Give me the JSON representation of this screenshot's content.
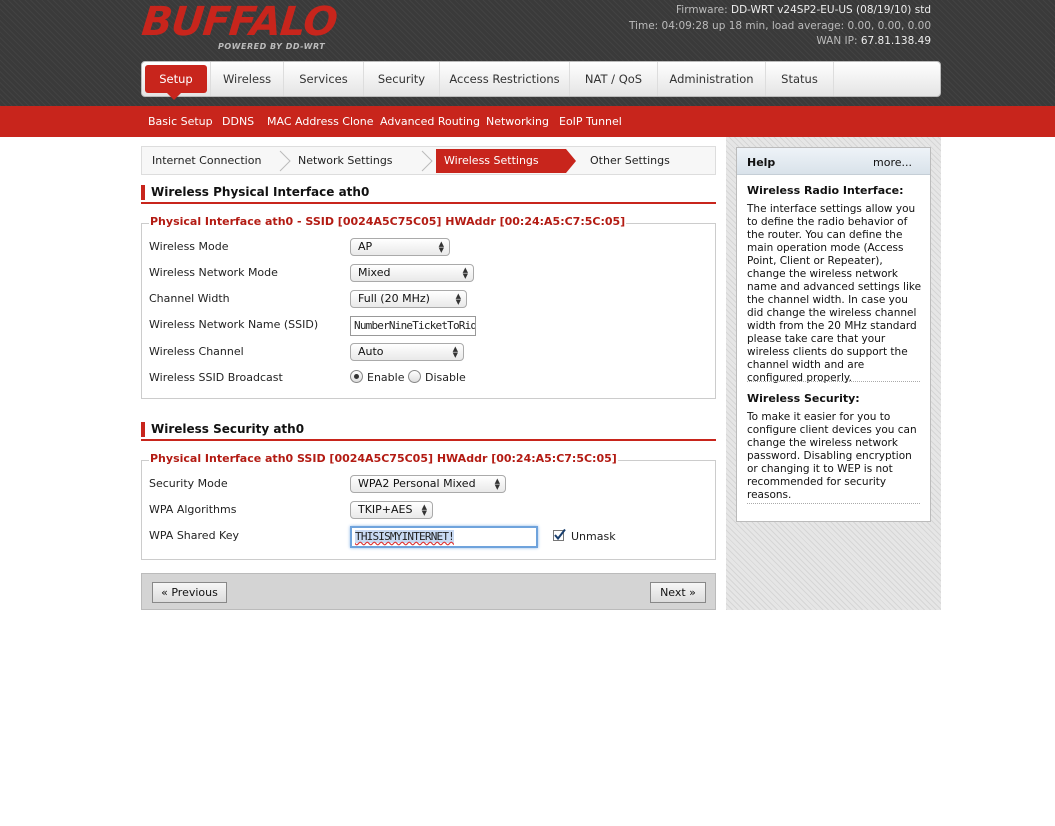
{
  "header": {
    "brand": "BUFFALO",
    "tagline": "POWERED BY DD-WRT",
    "firmware_label": "Firmware:",
    "firmware_value": "DD-WRT v24SP2-EU-US (08/19/10) std",
    "time_label": "Time:",
    "time_value": "04:09:28 up 18 min, load average: 0.00, 0.00, 0.00",
    "wanip_label": "WAN IP:",
    "wanip_value": "67.81.138.49"
  },
  "main_nav": [
    "Setup",
    "Wireless",
    "Services",
    "Security",
    "Access Restrictions",
    "NAT / QoS",
    "Administration",
    "Status"
  ],
  "sub_nav": [
    "Basic Setup",
    "DDNS",
    "MAC Address Clone",
    "Advanced Routing",
    "Networking",
    "EoIP Tunnel"
  ],
  "wizard": [
    "Internet Connection",
    "Network Settings",
    "Wireless Settings",
    "Other Settings"
  ],
  "section1": {
    "title": "Wireless Physical Interface ath0",
    "legend": "Physical Interface ath0 - SSID [0024A5C75C05] HWAddr [00:24:A5:C7:5C:05]",
    "labels": {
      "mode": "Wireless Mode",
      "netmode": "Wireless Network Mode",
      "width": "Channel Width",
      "ssid": "Wireless Network Name (SSID)",
      "channel": "Wireless Channel",
      "broadcast": "Wireless SSID Broadcast"
    },
    "values": {
      "mode": "AP",
      "netmode": "Mixed",
      "width": "Full (20 MHz)",
      "ssid": "NumberNineTicketToRide",
      "channel": "Auto",
      "enable": "Enable",
      "disable": "Disable"
    }
  },
  "section2": {
    "title": "Wireless Security ath0",
    "legend": "Physical Interface ath0 SSID [0024A5C75C05] HWAddr [00:24:A5:C7:5C:05]",
    "labels": {
      "secmode": "Security Mode",
      "algo": "WPA Algorithms",
      "key": "WPA Shared Key"
    },
    "values": {
      "secmode": "WPA2 Personal Mixed",
      "algo": "TKIP+AES",
      "key": "THISISMYINTERNET!",
      "unmask": "Unmask"
    }
  },
  "buttons": {
    "previous": "« Previous",
    "next": "Next »"
  },
  "help": {
    "title": "Help",
    "more": "more...",
    "h1": "Wireless Radio Interface:",
    "p1": "The interface settings allow you to define the radio behavior of the router. You can define the main operation mode (Access Point, Client or Repeater), change the wireless network name and advanced settings like the channel width. In case you did change the wireless channel width from the 20 MHz standard please take care that your wireless clients do support the channel width and are configured properly.",
    "h2": "Wireless Security:",
    "p2": "To make it easier for you to configure client devices you can change the wireless network password. Disabling encryption or changing it to WEP is not recommended for security reasons."
  },
  "colors": {
    "accent": "#c8251c",
    "legend": "#b31b13"
  }
}
